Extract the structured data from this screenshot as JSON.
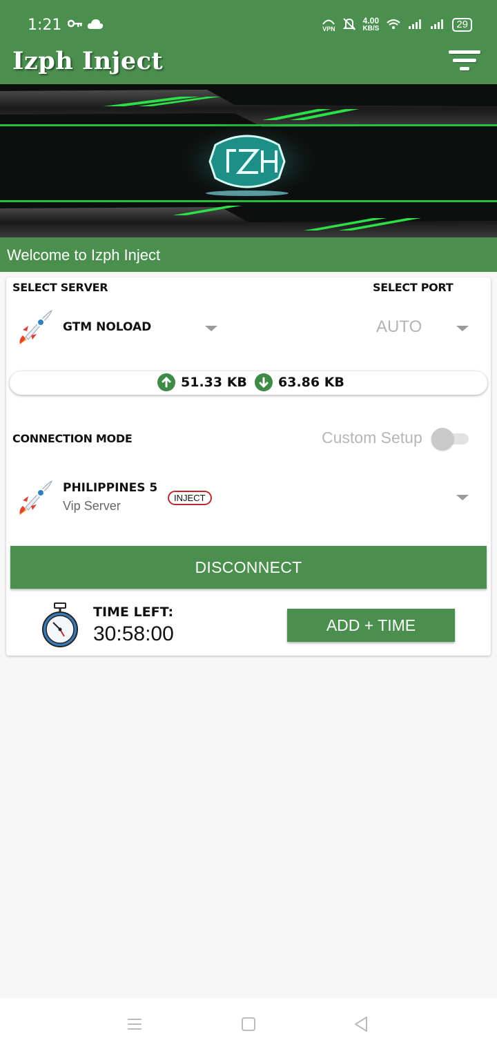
{
  "status_bar": {
    "time": "1:21",
    "vpn_label": "VPN",
    "speed_value": "4.00",
    "speed_unit": "KB/S",
    "battery": "29",
    "icons": [
      "key-icon",
      "cloud-icon",
      "vpn-icon",
      "mute-icon",
      "wifi-icon",
      "signal-icon",
      "signal-icon",
      "battery-icon"
    ]
  },
  "app_bar": {
    "title": "Izph Inject",
    "menu_icon": "filter-menu-icon"
  },
  "banner": {
    "logo_icon": "izph-logo"
  },
  "welcome": {
    "text": "Welcome to Izph Inject"
  },
  "server": {
    "label": "SELECT SERVER",
    "selected": "GTM NOLOAD",
    "icon": "rocket-icon"
  },
  "port": {
    "label": "SELECT PORT",
    "selected": "AUTO"
  },
  "traffic": {
    "upload": "51.33 KB",
    "download": "63.86 KB"
  },
  "connection_mode": {
    "label": "CONNECTION MODE",
    "custom_setup_label": "Custom Setup",
    "custom_setup_enabled": false,
    "selected_name": "PHILIPPINES 5",
    "selected_sub": "Vip Server",
    "badge": "INJECT"
  },
  "actions": {
    "disconnect_label": "DISCONNECT",
    "time_left_label": "TIME LEFT:",
    "time_left_value": "30:58:00",
    "add_time_label": "ADD + TIME"
  },
  "colors": {
    "primary": "#4a8f4e",
    "badge_border": "#c0272d"
  }
}
